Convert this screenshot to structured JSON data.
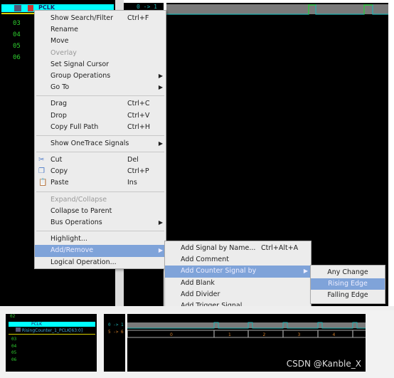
{
  "top_panel": {
    "signal_name": "PCLK",
    "groups": [
      "03",
      "04",
      "05",
      "06"
    ],
    "transition_label": "0 -> 1"
  },
  "context_menu": {
    "items": [
      {
        "label": "Show Search/Filter",
        "shortcut": "Ctrl+F"
      },
      {
        "label": "Rename"
      },
      {
        "label": "Move"
      },
      {
        "label": "Overlay",
        "disabled": true
      },
      {
        "label": "Set Signal Cursor"
      },
      {
        "label": "Group Operations",
        "submenu": true
      },
      {
        "label": "Go To",
        "submenu": true
      },
      {
        "sep": true
      },
      {
        "label": "Drag",
        "shortcut": "Ctrl+C"
      },
      {
        "label": "Drop",
        "shortcut": "Ctrl+V"
      },
      {
        "label": "Copy Full Path",
        "shortcut": "Ctrl+H"
      },
      {
        "sep": true
      },
      {
        "label": "Show OneTrace Signals",
        "submenu": true
      },
      {
        "sep": true
      },
      {
        "label": "Cut",
        "shortcut": "Del",
        "icon": "cut-icon"
      },
      {
        "label": "Copy",
        "shortcut": "Ctrl+P",
        "icon": "copy-icon"
      },
      {
        "label": "Paste",
        "shortcut": "Ins",
        "icon": "paste-icon"
      },
      {
        "sep": true
      },
      {
        "label": "Expand/Collapse",
        "disabled": true
      },
      {
        "label": "Collapse to Parent"
      },
      {
        "label": "Bus Operations",
        "submenu": true
      },
      {
        "sep": true
      },
      {
        "label": "Highlight..."
      },
      {
        "label": "Add/Remove",
        "submenu": true,
        "highlighted": true
      },
      {
        "label": "Logical Operation..."
      }
    ]
  },
  "add_remove_submenu": {
    "items": [
      {
        "label": "Add Signal by Name...",
        "shortcut": "Ctrl+Alt+A"
      },
      {
        "label": "Add Comment"
      },
      {
        "label": "Add Counter Signal by",
        "submenu": true,
        "highlighted": true
      },
      {
        "label": "Add Blank"
      },
      {
        "label": "Add Divider"
      },
      {
        "label": "Add Trigger Signal"
      }
    ]
  },
  "counter_submenu": {
    "items": [
      {
        "label": "Any Change"
      },
      {
        "label": "Rising Edge",
        "highlighted": true
      },
      {
        "label": "Falling Edge"
      }
    ]
  },
  "bottom_panel": {
    "group_top": "02",
    "signal_name": "PCLK",
    "counter_signal": "RisingCounter_1_PCLK[63:0]",
    "groups": [
      "03",
      "04",
      "05",
      "06"
    ],
    "transition_1": "0 -> 1",
    "transition_2": "5 -> 6",
    "counter_values": [
      "0",
      "1",
      "2",
      "3",
      "4",
      "5"
    ]
  },
  "watermark": "CSDN @Kanble_X",
  "colors": {
    "signal_highlight": "#00ffff",
    "menu_highlight": "#7fa3d9",
    "group_text": "#2ecc2e",
    "counter_text": "#d9822b"
  }
}
